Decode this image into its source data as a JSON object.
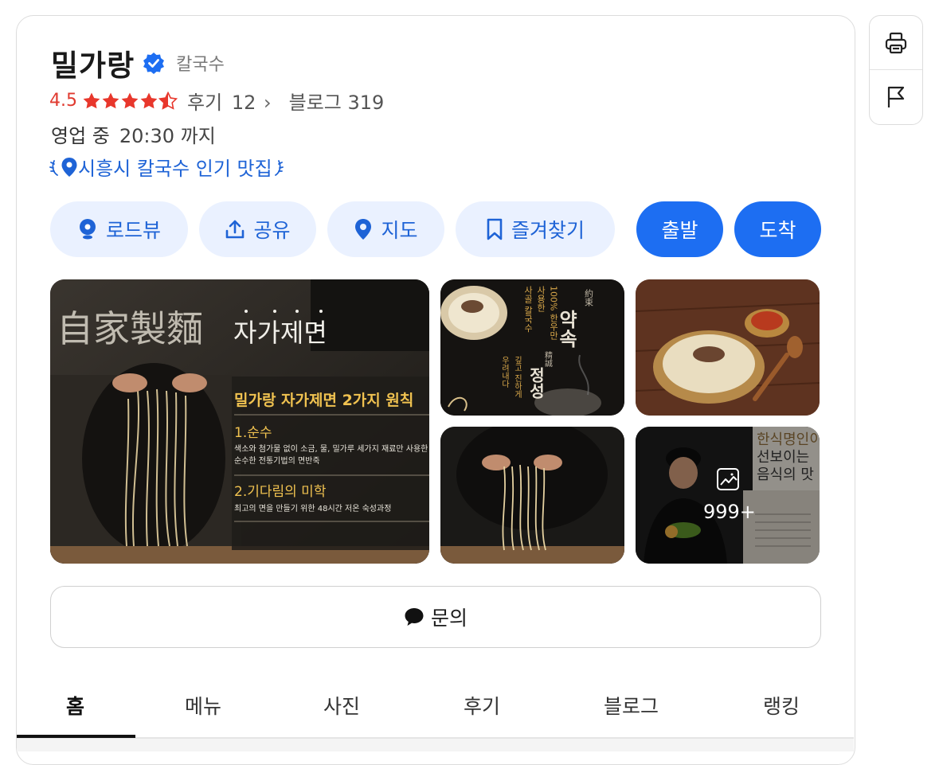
{
  "place": {
    "name": "밀가랑",
    "category": "칼국수",
    "rating": "4.5",
    "rating_value": 4.5,
    "reviews_label": "후기",
    "reviews_count": "12",
    "blog_label": "블로그",
    "blog_count": "319",
    "hours_status": "영업 중",
    "hours_time": "20:30 까지",
    "badge": "시흥시 칼국수 인기 맛집"
  },
  "actions": [
    {
      "label": "로드뷰",
      "icon": "roadview-icon"
    },
    {
      "label": "공유",
      "icon": "share-icon"
    },
    {
      "label": "지도",
      "icon": "map-pin-icon"
    },
    {
      "label": "즐겨찾기",
      "icon": "bookmark-icon"
    },
    {
      "label": "출발"
    },
    {
      "label": "도착"
    }
  ],
  "photos": {
    "main": {
      "hanja": "自家製麵",
      "heading": "자가제면",
      "subheading": "밀가랑 자가제면 2가지 원칙",
      "rule1_title": "1.순수",
      "rule1_text": "색소와 첨가물 없이 소금, 물, 밀가루 세가지 재료만 사용한 순수한 전통기법의 면반죽",
      "rule2_title": "2.기다림의 미학",
      "rule2_text": "최고의 면을 만들기 위한 48시간 저온 숙성과정"
    },
    "promo": {
      "title": "약속",
      "hanja_title": "約束",
      "vertical1": "100% 한우만",
      "vertical2": "사용한",
      "vertical3": "사골 칼국수",
      "title2": "정성",
      "hanja_title2": "精誠",
      "vertical4": "깊고 진하게",
      "vertical5": "우려내다"
    },
    "chef": {
      "line1": "한식명인이",
      "line2": "선보이는",
      "line3": "음식의 맛"
    },
    "more_count": "999+"
  },
  "inquiry_label": "문의",
  "tabs": [
    "홈",
    "메뉴",
    "사진",
    "후기",
    "블로그",
    "랭킹"
  ],
  "colors": {
    "accent": "#1d6ef2",
    "star": "#e8372c",
    "pill_bg": "#eaf1ff"
  }
}
